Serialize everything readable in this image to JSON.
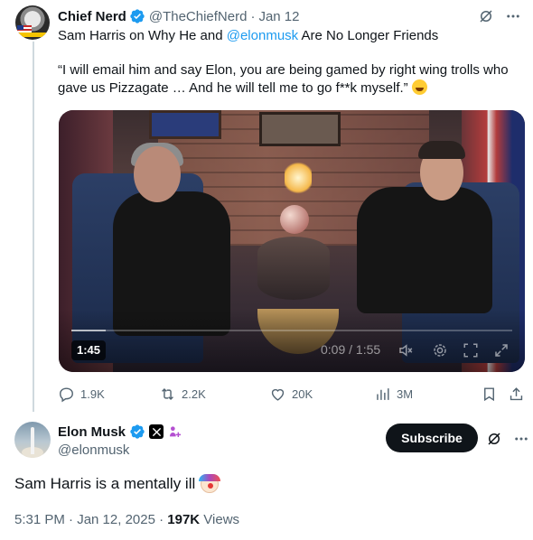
{
  "colors": {
    "accent": "#1d9bf0",
    "text_primary": "#0f1419",
    "text_secondary": "#536471",
    "verified_badge": "#1d9bf0",
    "subscribe_bg": "#0f1419"
  },
  "quoted_tweet": {
    "author_name": "Chief Nerd",
    "author_handle": "@TheChiefNerd",
    "separator": "·",
    "date": "Jan 12",
    "text_pre_mention": "Sam Harris on Why He and ",
    "mention": "@elonmusk",
    "text_post_mention": " Are No Longer Friends",
    "quote": "“I will email him and say Elon,  you are being gamed by right wing trolls who gave us Pizzagate … And he will tell me to go f**k myself.”",
    "quote_emoji": "rolling-on-floor-laughing-emoji",
    "video": {
      "duration": "1:45",
      "current_time": "0:09 / 1:55",
      "progress": 0.078
    },
    "actions": {
      "replies": "1.9K",
      "reposts": "2.2K",
      "likes": "20K",
      "views": "3M"
    }
  },
  "reply_tweet": {
    "author_name": "Elon Musk",
    "author_handle": "@elonmusk",
    "subscribe_label": "Subscribe",
    "text": "Sam Harris is a mentally ill",
    "text_emoji": "clown-face-emoji",
    "timestamp": "5:31 PM · Jan 12, 2025 · ",
    "views_count": "197K",
    "views_label": " Views"
  },
  "icons": [
    "verified-badge-icon",
    "grok-icon",
    "more-icon",
    "reply-icon",
    "repost-icon",
    "like-icon",
    "views-icon",
    "bookmark-icon",
    "share-icon",
    "x-logo-icon",
    "pride-icon",
    "mute-icon",
    "settings-icon",
    "fullscreen-icon",
    "expand-icon"
  ]
}
